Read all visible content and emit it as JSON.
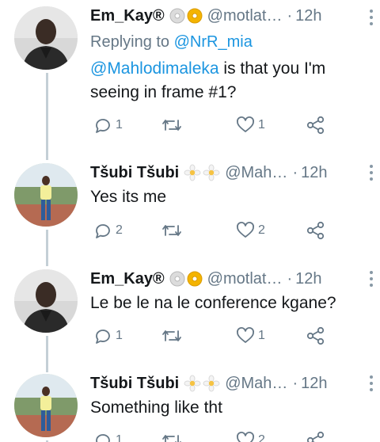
{
  "tweets": [
    {
      "display_name": "Em_Kay®",
      "handle": "@motlat…",
      "separator": "·",
      "time": "12h",
      "badges": [
        "cd-icon",
        "dvd-icon"
      ],
      "reply_prefix": "Replying to",
      "reply_handle": "@NrR_mia",
      "mention": "@Mahlodimaleka",
      "text": " is that you I'm seeing in frame #1?",
      "replies": "1",
      "retweets": "",
      "likes": "1"
    },
    {
      "display_name": "Tšubi Tšubi",
      "handle": "@Mah…",
      "separator": "·",
      "time": "12h",
      "badges": [
        "flower-icon",
        "flower-icon"
      ],
      "text": "Yes its me",
      "replies": "2",
      "retweets": "",
      "likes": "2"
    },
    {
      "display_name": "Em_Kay®",
      "handle": "@motlat…",
      "separator": "·",
      "time": "12h",
      "badges": [
        "cd-icon",
        "dvd-icon"
      ],
      "text": "Le be le na le conference kgane?",
      "replies": "1",
      "retweets": "",
      "likes": "1"
    },
    {
      "display_name": "Tšubi Tšubi",
      "handle": "@Mah…",
      "separator": "·",
      "time": "12h",
      "badges": [
        "flower-icon",
        "flower-icon"
      ],
      "text": "Something like tht",
      "replies": "1",
      "retweets": "",
      "likes": "2"
    }
  ],
  "colors": {
    "link": "#1b95e0",
    "muted": "#657786",
    "thread_line": "#c4cfd6"
  }
}
